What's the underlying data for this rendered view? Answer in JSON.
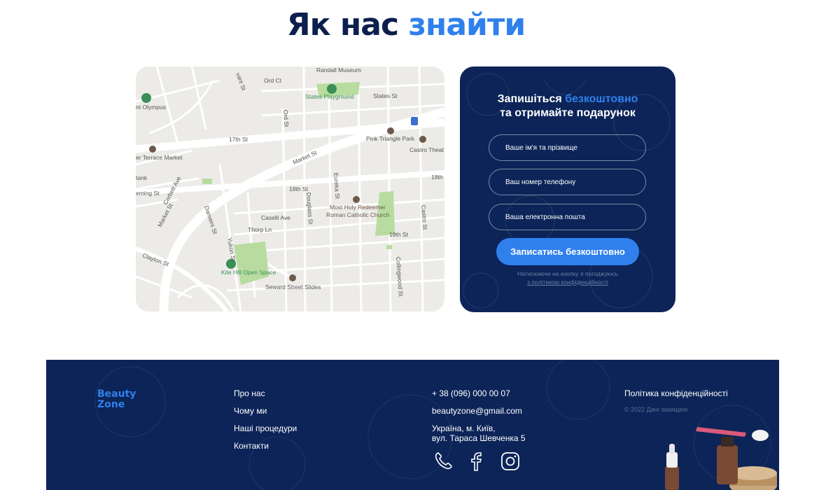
{
  "section": {
    "title_main": "Як нас ",
    "title_accent": "знайти"
  },
  "map": {
    "labels": {
      "randall_museum": "Randall Museum",
      "states_playground": "States Playground",
      "states_st": "States St",
      "mt_olympus": "nt Olympus",
      "st_17th": "17th St",
      "pink_triangle_park": "Pink Triangle Park",
      "castro_theatre": "Castro Theat",
      "terrace_market": "er Terrace Market",
      "market_st_1": "Market St",
      "st_18th": "18th St",
      "st_18th_right": "18th",
      "most_holy_1": "Most Holy Redeemer",
      "most_holy_2": "Roman Catholic Church",
      "caselli_ave": "Caselli Ave",
      "thorp_ln": "Thorp Ln",
      "st_19th": "19th St",
      "market_st_2": "Market St",
      "corbett_ave": "Corbett Ave",
      "danvers_st": "Danvers St",
      "douglass_st": "Douglass St",
      "eureka_st": "Eureka St",
      "castro_st": "Castro St",
      "collingwood_st": "Collingwood St",
      "ord_st": "Ord St",
      "ord_ct": "Ord Ct",
      "yukon_st": "Yukon St",
      "clayton_st": "Clayton St",
      "kite_hill": "Kite Hill Open Space",
      "seward_slides": "Seward Street Slides",
      "mming_st": "eming St",
      "tank": "tank",
      "vant_st": "vant St"
    }
  },
  "form": {
    "title_line1_main": "Запишіться ",
    "title_line1_accent": "безкоштовно",
    "title_line2": "та отримайте подарунок",
    "name_placeholder": "Ваше ім'я та прізвище",
    "phone_placeholder": "Ваш номер телефону",
    "email_placeholder": "Ваша електронна пошта",
    "submit_label": "Записатись безкоштовно",
    "consent_text": "Натискаючи на кнопку я погоджуюсь",
    "consent_link": "з політикою конфіденційності"
  },
  "footer": {
    "logo_line1": "Beauty",
    "logo_line2": "Zone",
    "nav": [
      "Про нас",
      "Чому ми",
      "Наші процедури",
      "Контакти"
    ],
    "phone": "+ 38 (096) 000 00 07",
    "email": "beautyzone@gmail.com",
    "address_line1": "Україна, м. Київ,",
    "address_line2": "вул. Тараса Шевченка 5",
    "policy": "Політика конфіденційності",
    "copyright": "© 2022 Дані захищені",
    "social_icons": [
      "phone-icon",
      "facebook-icon",
      "instagram-icon"
    ]
  },
  "colors": {
    "navy": "#0c2458",
    "accent_blue": "#2f80ed",
    "title_navy": "#0c1f4d",
    "map_bg": "#ecebe7",
    "map_green": "#b8dca0"
  }
}
